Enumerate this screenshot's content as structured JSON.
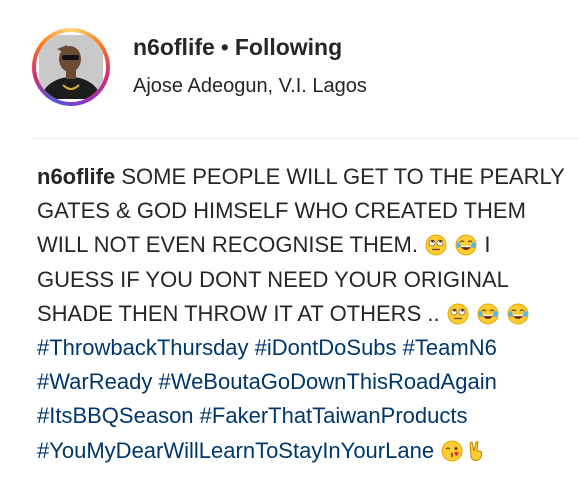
{
  "header": {
    "username": "n6oflife",
    "separator": "•",
    "following_label": "Following",
    "location": "Ajose Adeogun, V.I. Lagos"
  },
  "caption": {
    "username": "n6oflife",
    "text_1": " SOME PEOPLE WILL GET TO THE PEARLY GATES & GOD HIMSELF WHO CREATED THEM WILL NOT EVEN RECOGNISE THEM. ",
    "text_2": " I GUESS IF YOU DONT NEED YOUR ORIGINAL SHADE THEN THROW IT AT OTHERS .. ",
    "hashtags": [
      "#ThrowbackThursday",
      "#iDontDoSubs",
      "#TeamN6",
      "#WarReady",
      "#WeBoutaGoDownThisRoadAgain",
      "#ItsBBQSeason",
      "#FakerThatTaiwanProducts",
      "#YouMyDearWillLearnToStayInYourLane"
    ],
    "emoji_group_1": [
      "eye-roll-emoji",
      "tears-of-joy-emoji"
    ],
    "emoji_group_2": [
      "eye-roll-emoji",
      "tears-of-joy-emoji",
      "tears-of-joy-emoji"
    ],
    "emoji_group_3": [
      "kissing-wink-emoji",
      "victory-hand-emoji"
    ]
  },
  "colors": {
    "text": "#262626",
    "hashtag": "#00376b",
    "divider": "#efefef"
  }
}
